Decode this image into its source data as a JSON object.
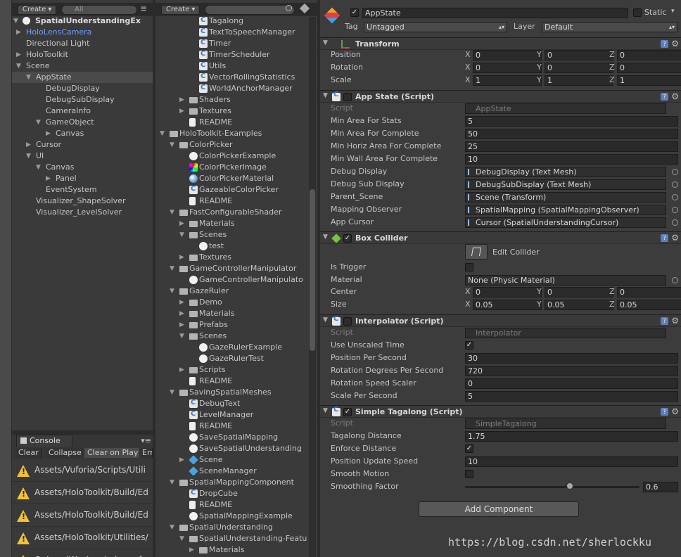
{
  "hierarchy": {
    "create_label": "Create",
    "search_placeholder": "All",
    "scene_name": "SpatialUnderstandingEx",
    "items": [
      {
        "label": "HoloLensCamera",
        "indent": 1,
        "arrow": "right",
        "color": "#6aa0ff"
      },
      {
        "label": "Directional Light",
        "indent": 1,
        "arrow": ""
      },
      {
        "label": "HoloToolkit",
        "indent": 1,
        "arrow": "right"
      },
      {
        "label": "Scene",
        "indent": 1,
        "arrow": "down"
      },
      {
        "label": "AppState",
        "indent": 2,
        "arrow": "down",
        "selected": true
      },
      {
        "label": "DebugDisplay",
        "indent": 3,
        "arrow": ""
      },
      {
        "label": "DebugSubDisplay",
        "indent": 3,
        "arrow": ""
      },
      {
        "label": "CameraInfo",
        "indent": 3,
        "arrow": ""
      },
      {
        "label": "GameObject",
        "indent": 3,
        "arrow": "down"
      },
      {
        "label": "Canvas",
        "indent": 4,
        "arrow": "right"
      },
      {
        "label": "Cursor",
        "indent": 2,
        "arrow": "right"
      },
      {
        "label": "UI",
        "indent": 2,
        "arrow": "down"
      },
      {
        "label": "Canvas",
        "indent": 3,
        "arrow": "down"
      },
      {
        "label": "Panel",
        "indent": 4,
        "arrow": "right"
      },
      {
        "label": "EventSystem",
        "indent": 3,
        "arrow": ""
      },
      {
        "label": "Visualizer_ShapeSolver",
        "indent": 2,
        "arrow": ""
      },
      {
        "label": "Visualizer_LevelSolver",
        "indent": 2,
        "arrow": ""
      }
    ]
  },
  "console": {
    "tab_label": "Console",
    "buttons": [
      "Clear",
      "Collapse",
      "Clear on Play",
      "Err"
    ],
    "messages": [
      "Assets/Vuforia/Scripts/Utili",
      "Assets/HoloToolkit/Build/Ed",
      "Assets/HoloToolkit/Build/Ed",
      "Assets/HoloToolkit/Utilities/",
      "OnLevelWasLoaded was fo"
    ]
  },
  "project": {
    "create_label": "Create",
    "items": [
      {
        "label": "Tagalong",
        "indent": 4,
        "icon": "cs"
      },
      {
        "label": "TextToSpeechManager",
        "indent": 4,
        "icon": "cs"
      },
      {
        "label": "Timer",
        "indent": 4,
        "icon": "cs"
      },
      {
        "label": "TimerScheduler",
        "indent": 4,
        "icon": "cs"
      },
      {
        "label": "Utils",
        "indent": 4,
        "icon": "cs"
      },
      {
        "label": "VectorRollingStatistics",
        "indent": 4,
        "icon": "cs"
      },
      {
        "label": "WorldAnchorManager",
        "indent": 4,
        "icon": "cs"
      },
      {
        "label": "Shaders",
        "indent": 3,
        "icon": "folder",
        "arrow": "right"
      },
      {
        "label": "Textures",
        "indent": 3,
        "icon": "folder",
        "arrow": "right"
      },
      {
        "label": "README",
        "indent": 3,
        "icon": "doc"
      },
      {
        "label": "HoloToolkit-Examples",
        "indent": 1,
        "icon": "folder",
        "arrow": "down"
      },
      {
        "label": "ColorPicker",
        "indent": 2,
        "icon": "folder",
        "arrow": "down"
      },
      {
        "label": "ColorPickerExample",
        "indent": 3,
        "icon": "scene"
      },
      {
        "label": "ColorPickerImage",
        "indent": 3,
        "icon": "img"
      },
      {
        "label": "ColorPickerMaterial",
        "indent": 3,
        "icon": "mat"
      },
      {
        "label": "GazeableColorPicker",
        "indent": 3,
        "icon": "cs"
      },
      {
        "label": "README",
        "indent": 3,
        "icon": "doc"
      },
      {
        "label": "FastConfigurableShader",
        "indent": 2,
        "icon": "folder",
        "arrow": "down"
      },
      {
        "label": "Materials",
        "indent": 3,
        "icon": "folder",
        "arrow": "right"
      },
      {
        "label": "Scenes",
        "indent": 3,
        "icon": "folder",
        "arrow": "down"
      },
      {
        "label": "test",
        "indent": 4,
        "icon": "scene"
      },
      {
        "label": "Textures",
        "indent": 3,
        "icon": "folder",
        "arrow": "right"
      },
      {
        "label": "GameControllerManipulator",
        "indent": 2,
        "icon": "folder",
        "arrow": "down"
      },
      {
        "label": "GameControllerManipulato",
        "indent": 3,
        "icon": "scene"
      },
      {
        "label": "GazeRuler",
        "indent": 2,
        "icon": "folder",
        "arrow": "down"
      },
      {
        "label": "Demo",
        "indent": 3,
        "icon": "folder",
        "arrow": "right"
      },
      {
        "label": "Materials",
        "indent": 3,
        "icon": "folder",
        "arrow": "right"
      },
      {
        "label": "Prefabs",
        "indent": 3,
        "icon": "folder",
        "arrow": "right"
      },
      {
        "label": "Scenes",
        "indent": 3,
        "icon": "folder",
        "arrow": "down"
      },
      {
        "label": "GazeRulerExample",
        "indent": 4,
        "icon": "scene"
      },
      {
        "label": "GazeRulerTest",
        "indent": 4,
        "icon": "scene"
      },
      {
        "label": "Scripts",
        "indent": 3,
        "icon": "folder",
        "arrow": "right"
      },
      {
        "label": "README",
        "indent": 3,
        "icon": "doc"
      },
      {
        "label": "SavingSpatialMeshes",
        "indent": 2,
        "icon": "folder",
        "arrow": "down"
      },
      {
        "label": "DebugText",
        "indent": 3,
        "icon": "cs"
      },
      {
        "label": "LevelManager",
        "indent": 3,
        "icon": "cs"
      },
      {
        "label": "README",
        "indent": 3,
        "icon": "doc"
      },
      {
        "label": "SaveSpatialMapping",
        "indent": 3,
        "icon": "scene"
      },
      {
        "label": "SaveSpatialUnderstanding",
        "indent": 3,
        "icon": "scene"
      },
      {
        "label": "Scene",
        "indent": 3,
        "icon": "prefab",
        "arrow": "right"
      },
      {
        "label": "SceneManager",
        "indent": 3,
        "icon": "prefab"
      },
      {
        "label": "SpatialMappingComponent",
        "indent": 2,
        "icon": "folder",
        "arrow": "down"
      },
      {
        "label": "DropCube",
        "indent": 3,
        "icon": "cs"
      },
      {
        "label": "README",
        "indent": 3,
        "icon": "doc"
      },
      {
        "label": "SpatialMappingExample",
        "indent": 3,
        "icon": "scene"
      },
      {
        "label": "SpatialUnderstanding",
        "indent": 2,
        "icon": "folder",
        "arrow": "down"
      },
      {
        "label": "SpatialUnderstanding-Featu",
        "indent": 3,
        "icon": "folder",
        "arrow": "down"
      },
      {
        "label": "Materials",
        "indent": 4,
        "icon": "folder",
        "arrow": "right"
      }
    ]
  },
  "inspector": {
    "object_name": "AppState",
    "static_label": "Static",
    "tag_label": "Tag",
    "tag_value": "Untagged",
    "layer_label": "Layer",
    "layer_value": "Default",
    "transform": {
      "title": "Transform",
      "position_label": "Position",
      "position": [
        "0",
        "0",
        "0"
      ],
      "rotation_label": "Rotation",
      "rotation": [
        "0",
        "0",
        "0"
      ],
      "scale_label": "Scale",
      "scale": [
        "1",
        "1",
        "1"
      ]
    },
    "app_state": {
      "title": "App State (Script)",
      "script_label": "Script",
      "script_value": "AppState",
      "fields": [
        {
          "label": "Min Area For Stats",
          "value": "5"
        },
        {
          "label": "Min Area For Complete",
          "value": "50"
        },
        {
          "label": "Min Horiz Area For Complete",
          "value": "25"
        },
        {
          "label": "Min Wall Area For Complete",
          "value": "10"
        },
        {
          "label": "Debug Display",
          "value": "DebugDisplay (Text Mesh)",
          "obj": true
        },
        {
          "label": "Debug Sub Display",
          "value": "DebugSubDisplay (Text Mesh)",
          "obj": true
        },
        {
          "label": "Parent_Scene",
          "value": "Scene (Transform)",
          "obj": true
        },
        {
          "label": "Mapping Observer",
          "value": "SpatialMapping (SpatialMappingObserver)",
          "obj": true
        },
        {
          "label": "App Cursor",
          "value": "Cursor (SpatialUnderstandingCursor)",
          "obj": true
        }
      ]
    },
    "box_collider": {
      "title": "Box Collider",
      "edit_label": "Edit Collider",
      "is_trigger_label": "Is Trigger",
      "material_label": "Material",
      "material_value": "None (Physic Material)",
      "center_label": "Center",
      "center": [
        "0",
        "0",
        "0"
      ],
      "size_label": "Size",
      "size": [
        "0.05",
        "0.05",
        "0.05"
      ]
    },
    "interpolator": {
      "title": "Interpolator (Script)",
      "script_label": "Script",
      "script_value": "Interpolator",
      "use_unscaled_label": "Use Unscaled Time",
      "fields": [
        {
          "label": "Position Per Second",
          "value": "30"
        },
        {
          "label": "Rotation Degrees Per Second",
          "value": "720"
        },
        {
          "label": "Rotation Speed Scaler",
          "value": "0"
        },
        {
          "label": "Scale Per Second",
          "value": "5"
        }
      ]
    },
    "tagalong": {
      "title": "Simple Tagalong (Script)",
      "script_label": "Script",
      "script_value": "SimpleTagalong",
      "tagalong_distance_label": "Tagalong Distance",
      "tagalong_distance": "1.75",
      "enforce_label": "Enforce Distance",
      "pos_update_label": "Position Update Speed",
      "pos_update": "10",
      "smooth_motion_label": "Smooth Motion",
      "smoothing_label": "Smoothing Factor",
      "smoothing": "0.6",
      "smoothing_fraction": 0.6
    },
    "add_component_label": "Add Component"
  },
  "watermark": "https://blog.csdn.net/sherlockku"
}
